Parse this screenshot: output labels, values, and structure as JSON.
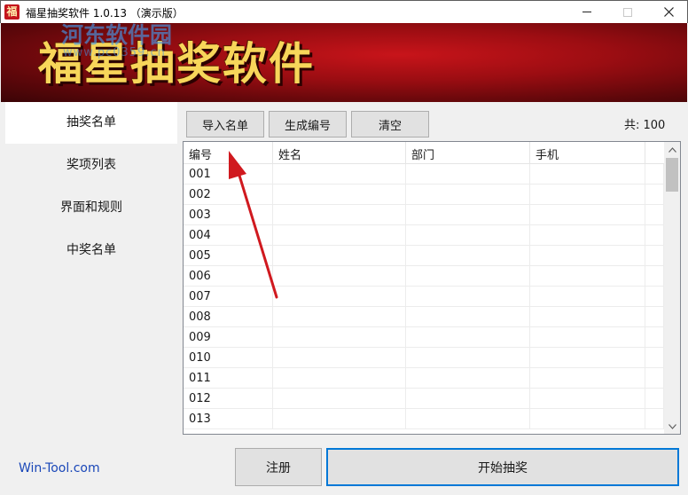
{
  "window": {
    "title": "福星抽奖软件 1.0.13 （演示版）",
    "icon_glyph": "福"
  },
  "banner": {
    "title": "福星抽奖软件",
    "watermark": "河东软件园",
    "watermark_url": "www.pc0359.cn"
  },
  "sidebar": {
    "items": [
      {
        "label": "抽奖名单",
        "active": true
      },
      {
        "label": "奖项列表",
        "active": false
      },
      {
        "label": "界面和规则",
        "active": false
      },
      {
        "label": "中奖名单",
        "active": false
      }
    ]
  },
  "toolbar": {
    "import_label": "导入名单",
    "generate_label": "生成编号",
    "clear_label": "清空",
    "count_text": "共: 100"
  },
  "table": {
    "columns": [
      "编号",
      "姓名",
      "部门",
      "手机"
    ],
    "rows": [
      {
        "num": "001",
        "name": "",
        "dept": "",
        "phone": ""
      },
      {
        "num": "002",
        "name": "",
        "dept": "",
        "phone": ""
      },
      {
        "num": "003",
        "name": "",
        "dept": "",
        "phone": ""
      },
      {
        "num": "004",
        "name": "",
        "dept": "",
        "phone": ""
      },
      {
        "num": "005",
        "name": "",
        "dept": "",
        "phone": ""
      },
      {
        "num": "006",
        "name": "",
        "dept": "",
        "phone": ""
      },
      {
        "num": "007",
        "name": "",
        "dept": "",
        "phone": ""
      },
      {
        "num": "008",
        "name": "",
        "dept": "",
        "phone": ""
      },
      {
        "num": "009",
        "name": "",
        "dept": "",
        "phone": ""
      },
      {
        "num": "010",
        "name": "",
        "dept": "",
        "phone": ""
      },
      {
        "num": "011",
        "name": "",
        "dept": "",
        "phone": ""
      },
      {
        "num": "012",
        "name": "",
        "dept": "",
        "phone": ""
      },
      {
        "num": "013",
        "name": "",
        "dept": "",
        "phone": ""
      }
    ]
  },
  "footer": {
    "link_text": "Win-Tool.com",
    "register_label": "注册",
    "start_label": "开始抽奖"
  },
  "colors": {
    "banner_red": "#9b0d12",
    "banner_title": "#f7d65a",
    "link_blue": "#1a47b8",
    "focus_blue": "#0078d7",
    "annotation_arrow": "#d0191f"
  }
}
